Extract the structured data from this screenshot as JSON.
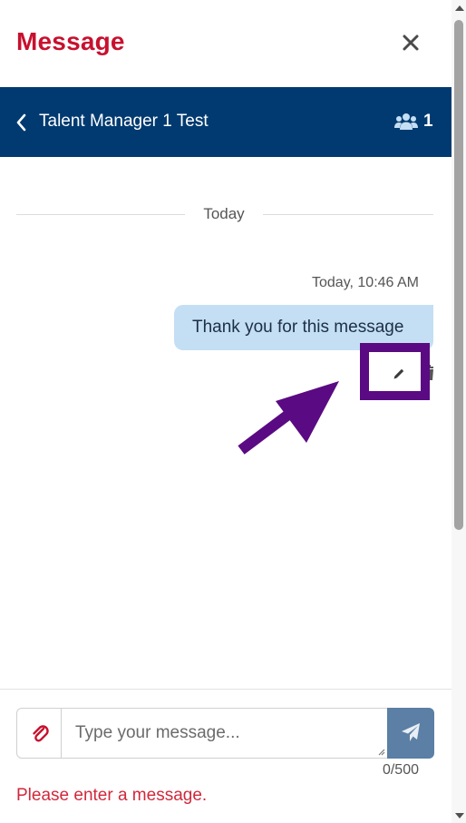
{
  "header": {
    "title": "Message",
    "close_icon": "close-icon"
  },
  "conversation": {
    "back_icon": "chevron-left-icon",
    "title": "Talent Manager 1 Test",
    "participants_icon": "users-icon",
    "participant_count": "1"
  },
  "thread": {
    "day_label": "Today",
    "messages": [
      {
        "timestamp": "Today, 10:46 AM",
        "text": "Thank you for this message",
        "actions": [
          "pencil-icon",
          "trash-icon"
        ]
      }
    ]
  },
  "annotation": {
    "type": "highlight-box-with-arrow",
    "color": "#5a0a82",
    "target": "edit-message-button"
  },
  "composer": {
    "attach_icon": "paperclip-icon",
    "placeholder": "Type your message...",
    "value": "",
    "send_icon": "paper-plane-icon",
    "char_count": "0/500",
    "error": "Please enter a message."
  },
  "colors": {
    "brand_red": "#c8102e",
    "bar_blue": "#003a70",
    "bubble_blue": "#c4def4",
    "send_blue": "#5b7fa5",
    "error_red": "#d0283c",
    "annotation_purple": "#5a0a82"
  }
}
